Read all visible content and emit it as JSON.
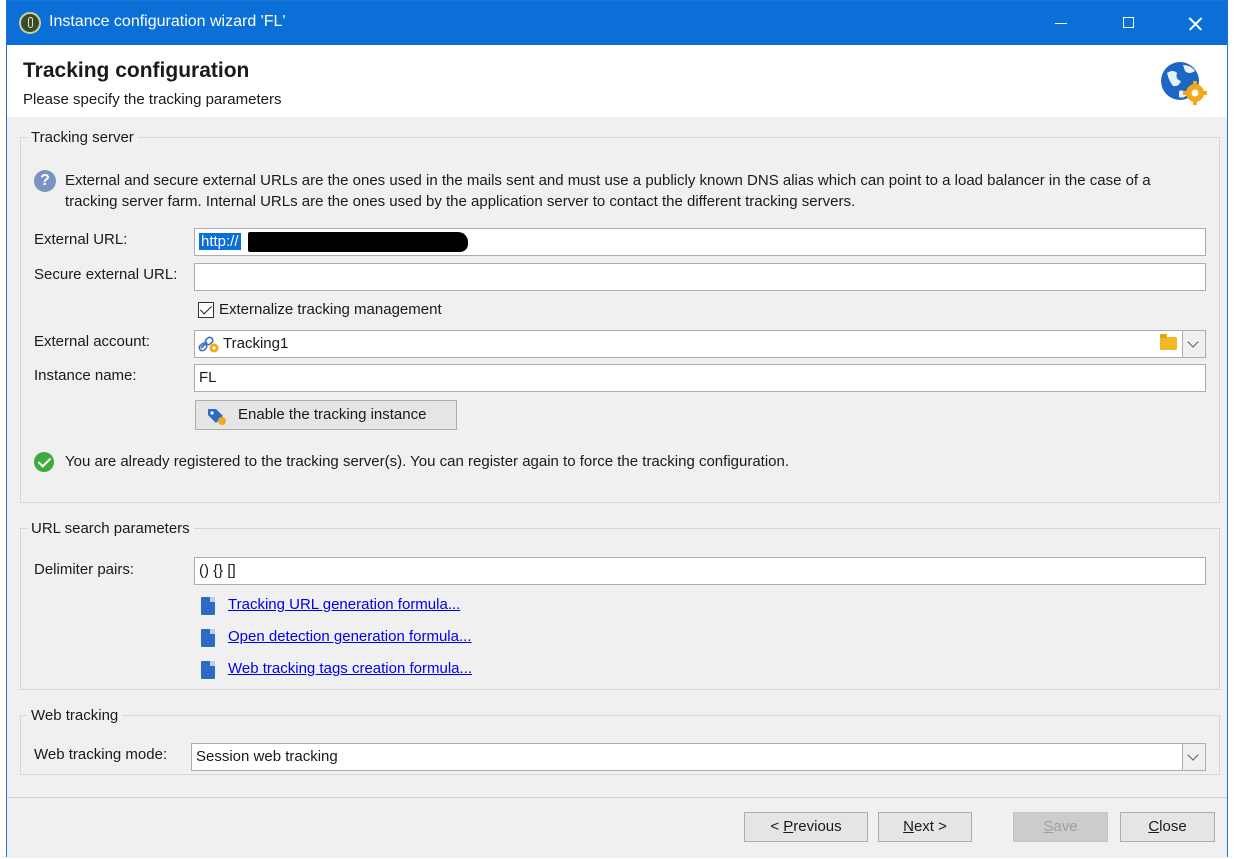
{
  "window": {
    "title": "Instance configuration wizard 'FL'"
  },
  "header": {
    "title": "Tracking configuration",
    "subtitle": "Please specify the tracking parameters"
  },
  "tracking_server": {
    "legend": "Tracking server",
    "info": "External and secure external URLs are the ones used in the mails sent and must use a publicly known DNS alias which can point to a load balancer in the case of a tracking server farm. Internal URLs are the ones used by the application server to contact the different tracking servers.",
    "external_url_label": "External URL:",
    "external_url_value": "http://",
    "secure_url_label": "Secure external URL:",
    "secure_url_value": "",
    "externalize_label": "Externalize tracking management",
    "externalize_checked": true,
    "external_account_label": "External account:",
    "external_account_value": "Tracking1",
    "instance_name_label": "Instance name:",
    "instance_name_value": "FL",
    "enable_button": "Enable the tracking instance",
    "status_message": "You are already registered to the tracking server(s). You can register again to force the tracking configuration."
  },
  "url_search": {
    "legend": "URL search parameters",
    "delimiter_label": "Delimiter pairs:",
    "delimiter_value": "() {} []",
    "links": [
      "Tracking URL generation formula...",
      "Open detection generation formula...",
      "Web tracking tags creation formula..."
    ]
  },
  "web_tracking": {
    "legend": "Web tracking",
    "mode_label": "Web tracking mode:",
    "mode_value": "Session web tracking"
  },
  "footer": {
    "previous_pre": "< ",
    "previous_key": "P",
    "previous_rest": "revious",
    "next_key": "N",
    "next_rest": "ext >",
    "save_key": "S",
    "save_rest": "ave",
    "close_key": "C",
    "close_rest": "lose"
  },
  "colors": {
    "titlebar": "#0a6fd6",
    "link": "#0000ee",
    "success": "#3eab3e"
  }
}
